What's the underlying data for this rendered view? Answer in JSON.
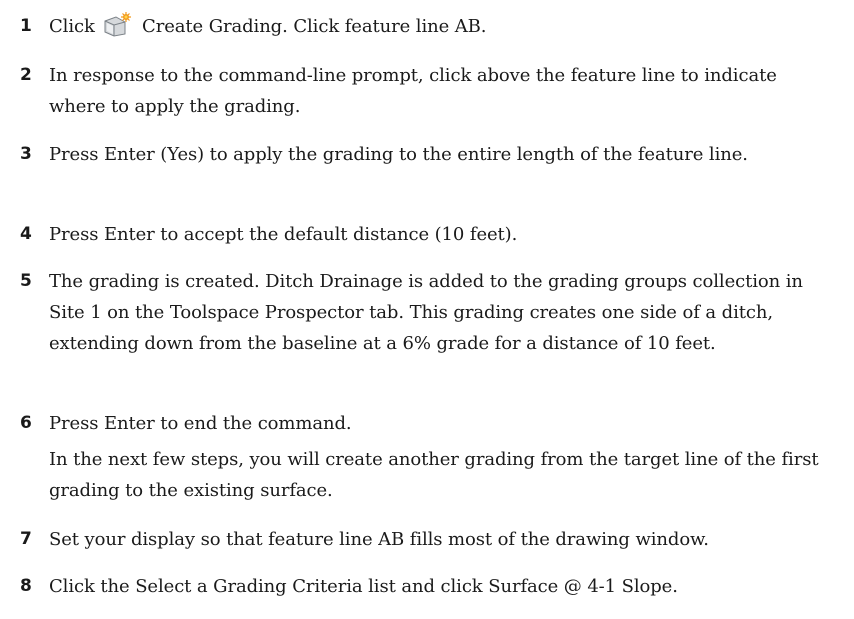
{
  "steps": [
    {
      "num": "1",
      "pre": "Click",
      "post": "Create Grading. Click feature line AB."
    },
    {
      "num": "2",
      "text": "In response to the command-line prompt, click above the feature line to indicate where to apply the grading."
    },
    {
      "num": "3",
      "text": "Press Enter (Yes) to apply the grading to the entire length of the feature line."
    },
    {
      "num": "4",
      "text": "Press Enter to accept the default distance (10 feet)."
    },
    {
      "num": "5",
      "text": "The grading is created. Ditch Drainage is added to the grading groups collection in Site 1 on the Toolspace Prospector tab. This grading creates one side of a ditch, extending down from the baseline at a 6% grade for a distance of 10 feet."
    },
    {
      "num": "6",
      "text": "Press Enter to end the command."
    },
    {
      "num": "7",
      "text": "Set your display so that feature line AB fills most of the drawing window."
    },
    {
      "num": "8",
      "text": "Click the Select a Grading Criteria list and click Surface @ 4-1 Slope."
    }
  ],
  "note": "In the next few steps, you will create another grading from the target line of the first grading to the existing surface.",
  "icons": {
    "create_grading": "create-grading-icon"
  },
  "colors": {
    "text": "#1a1a1a",
    "icon_sun": "#f29a1f"
  }
}
